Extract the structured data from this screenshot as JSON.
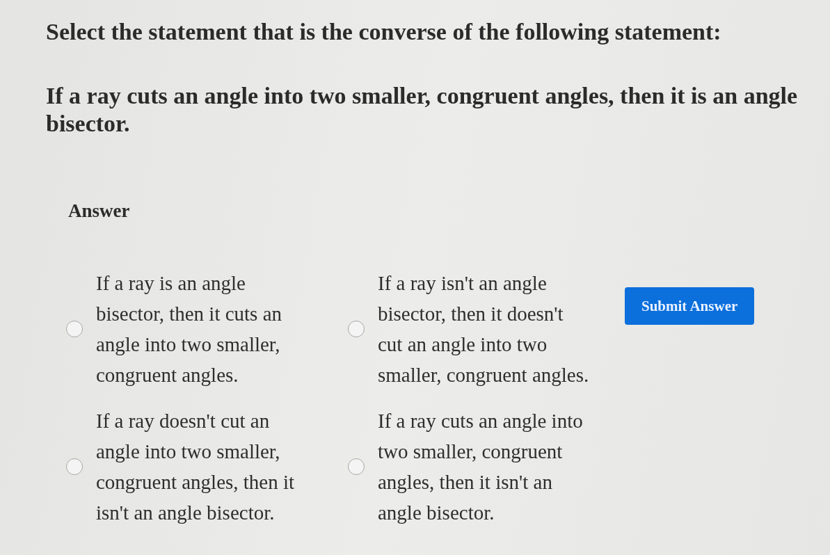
{
  "question": {
    "prompt": "Select the statement that is the converse of the following statement:",
    "statement": "If a ray cuts an angle into two smaller, congruent angles, then it is an angle bisector."
  },
  "answer": {
    "heading": "Answer",
    "options": [
      {
        "text": "If a ray is an angle bisector, then it cuts an angle into two smaller, congruent angles.",
        "selected": false
      },
      {
        "text": "If a ray isn't an angle bisector, then it doesn't cut an angle into two smaller, congruent angles.",
        "selected": false
      },
      {
        "text": "If a ray doesn't cut an angle into two smaller, congruent angles, then it isn't an angle bisector.",
        "selected": false
      },
      {
        "text": "If a ray cuts an angle into two smaller, congruent angles, then it isn't an angle bisector.",
        "selected": false
      }
    ],
    "submit_button": "Submit Answer"
  }
}
